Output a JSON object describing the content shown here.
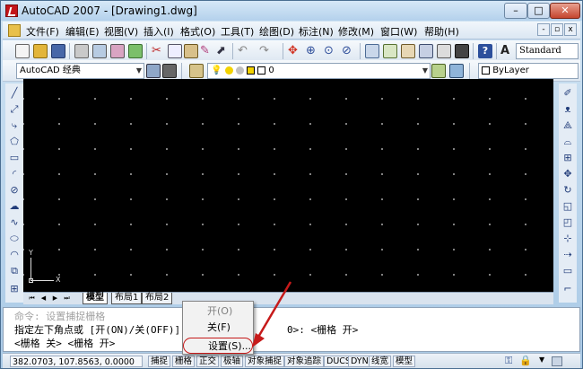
{
  "window": {
    "title": "AutoCAD 2007 - [Drawing1.dwg]",
    "min_label": "–",
    "max_label": "□",
    "close_label": "✕"
  },
  "menubar": {
    "items": [
      "文件(F)",
      "编辑(E)",
      "视图(V)",
      "插入(I)",
      "格式(O)",
      "工具(T)",
      "绘图(D)",
      "标注(N)",
      "修改(M)",
      "窗口(W)",
      "帮助(H)"
    ],
    "mdi_min": "-",
    "mdi_restore": "▫",
    "mdi_close": "x"
  },
  "toolbar": {
    "workspace": "AutoCAD 经典",
    "text_style": "Standard",
    "layer": "0",
    "color": "ByLayer"
  },
  "layout_tabs": [
    "模型",
    "布局1",
    "布局2"
  ],
  "command": {
    "line1": "命令: 设置捕捉栅格",
    "line2": "指定左下角点或 [开(ON)/关(OFF)]",
    "line2_end": "0>:  <栅格 开>",
    "line3": "<栅格 关>  <栅格 开>"
  },
  "context_menu": {
    "items": [
      {
        "label": "开(O)"
      },
      {
        "label": "关(F)"
      },
      {
        "label": "设置(S)..."
      }
    ]
  },
  "status": {
    "coords": "382.0703, 107.8563, 0.0000",
    "buttons": [
      "捕捉",
      "栅格",
      "正交",
      "极轴",
      "对象捕捉",
      "对象追踪",
      "DUCS",
      "DYN",
      "线宽",
      "模型"
    ]
  },
  "colors": {
    "accent_red": "#c61a1a",
    "canvas": "#000000"
  }
}
